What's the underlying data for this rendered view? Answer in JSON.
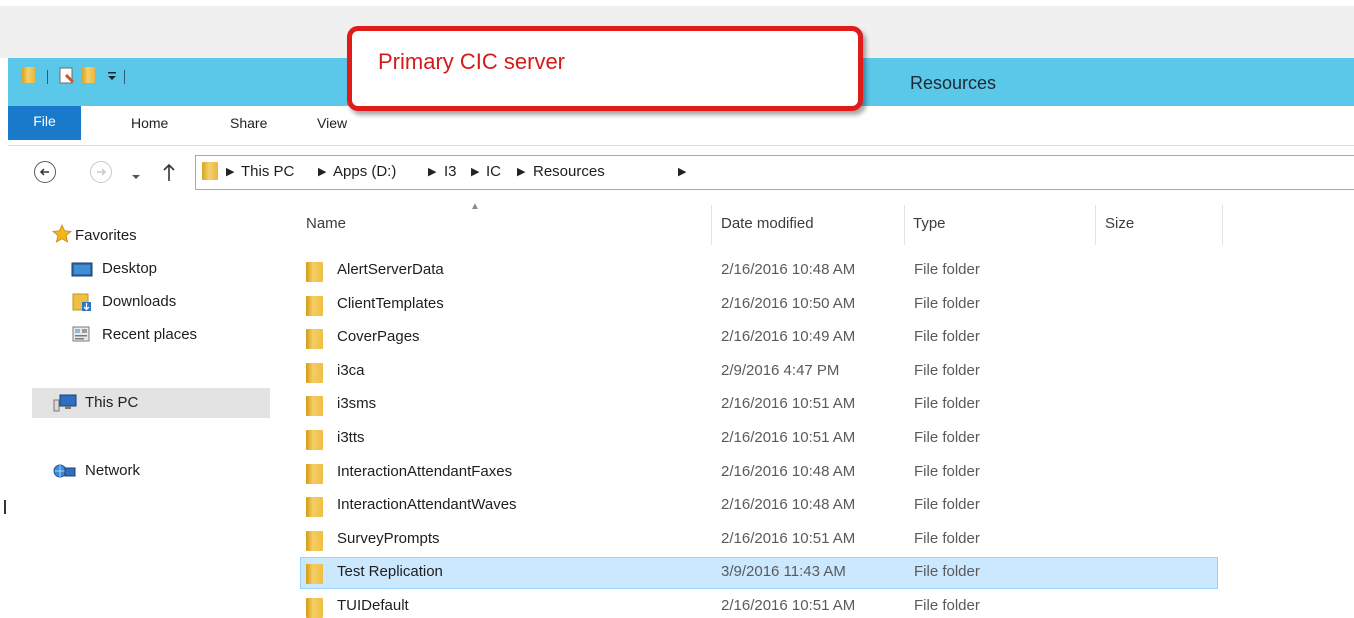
{
  "window": {
    "title": "Resources"
  },
  "callout": {
    "text": "Primary CIC server"
  },
  "ribbon": {
    "tabs": [
      "File",
      "Home",
      "Share",
      "View"
    ]
  },
  "address": {
    "crumbs": [
      "This PC",
      "Apps (D:)",
      "I3",
      "IC",
      "Resources"
    ]
  },
  "sidebar": {
    "favorites_label": "Favorites",
    "favorites": [
      "Desktop",
      "Downloads",
      "Recent places"
    ],
    "this_pc": "This PC",
    "network": "Network"
  },
  "columns": {
    "name": "Name",
    "date": "Date modified",
    "type": "Type",
    "size": "Size"
  },
  "files": [
    {
      "name": "AlertServerData",
      "date": "2/16/2016 10:48 AM",
      "type": "File folder"
    },
    {
      "name": "ClientTemplates",
      "date": "2/16/2016 10:50 AM",
      "type": "File folder"
    },
    {
      "name": "CoverPages",
      "date": "2/16/2016 10:49 AM",
      "type": "File folder"
    },
    {
      "name": "i3ca",
      "date": "2/9/2016 4:47 PM",
      "type": "File folder"
    },
    {
      "name": "i3sms",
      "date": "2/16/2016 10:51 AM",
      "type": "File folder"
    },
    {
      "name": "i3tts",
      "date": "2/16/2016 10:51 AM",
      "type": "File folder"
    },
    {
      "name": "InteractionAttendantFaxes",
      "date": "2/16/2016 10:48 AM",
      "type": "File folder"
    },
    {
      "name": "InteractionAttendantWaves",
      "date": "2/16/2016 10:48 AM",
      "type": "File folder"
    },
    {
      "name": "SurveyPrompts",
      "date": "2/16/2016 10:51 AM",
      "type": "File folder"
    },
    {
      "name": "Test Replication",
      "date": "3/9/2016 11:43 AM",
      "type": "File folder"
    },
    {
      "name": "TUIDefault",
      "date": "2/16/2016 10:51 AM",
      "type": "File folder"
    }
  ],
  "selected_file_index": 9,
  "colors": {
    "title_bar": "#5bc8ea",
    "file_tab": "#1979ca",
    "callout_border": "#e11a1a",
    "selection": "#cce8ff"
  }
}
